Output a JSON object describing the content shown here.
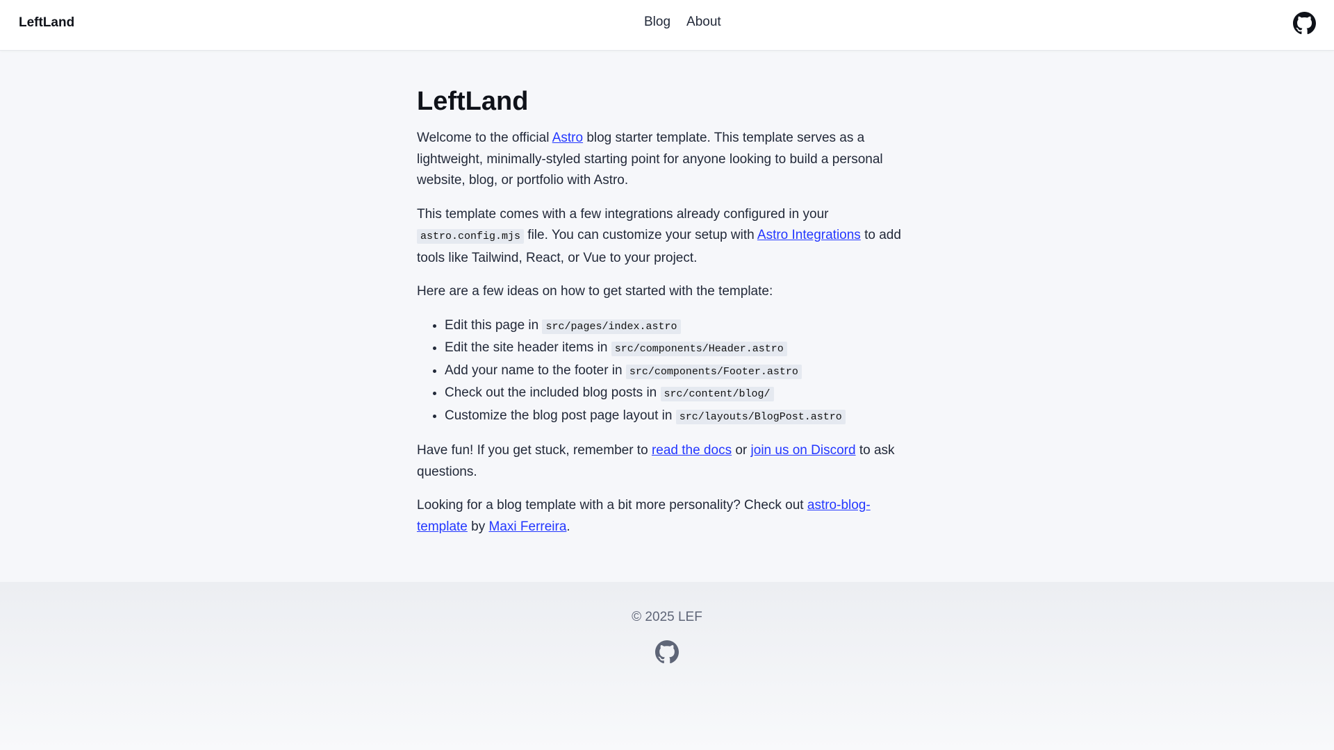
{
  "header": {
    "site_title": "LeftLand",
    "nav": [
      {
        "label": "Blog"
      },
      {
        "label": "About"
      }
    ],
    "github_icon": "github-icon"
  },
  "main": {
    "title": "LeftLand",
    "p1": {
      "before": "Welcome to the official ",
      "link": "Astro",
      "after": " blog starter template. This template serves as a lightweight, minimally-styled starting point for anyone looking to build a personal website, blog, or portfolio with Astro."
    },
    "p2": {
      "before": "This template comes with a few integrations already configured in your ",
      "code": "astro.config.mjs",
      "middle": " file. You can customize your setup with ",
      "link": "Astro Integrations",
      "after": " to add tools like Tailwind, React, or Vue to your project."
    },
    "p3": "Here are a few ideas on how to get started with the template:",
    "list": [
      {
        "text": "Edit this page in ",
        "code": "src/pages/index.astro"
      },
      {
        "text": "Edit the site header items in ",
        "code": "src/components/Header.astro"
      },
      {
        "text": "Add your name to the footer in ",
        "code": "src/components/Footer.astro"
      },
      {
        "text": "Check out the included blog posts in ",
        "code": "src/content/blog/"
      },
      {
        "text": "Customize the blog post page layout in ",
        "code": "src/layouts/BlogPost.astro"
      }
    ],
    "p4": {
      "before": "Have fun! If you get stuck, remember to ",
      "link1": "read the docs",
      "middle": " or ",
      "link2": "join us on Discord",
      "after": " to ask questions."
    },
    "p5": {
      "before": "Looking for a blog template with a bit more personality? Check out ",
      "link1": "astro-blog-template",
      "middle": " by ",
      "link2": "Maxi Ferreira",
      "after": "."
    }
  },
  "footer": {
    "copyright": "© 2025 LEF",
    "github_icon": "github-icon"
  },
  "colors": {
    "accent": "#2337ff",
    "background": "#f6f7fa",
    "text": "#222939"
  }
}
